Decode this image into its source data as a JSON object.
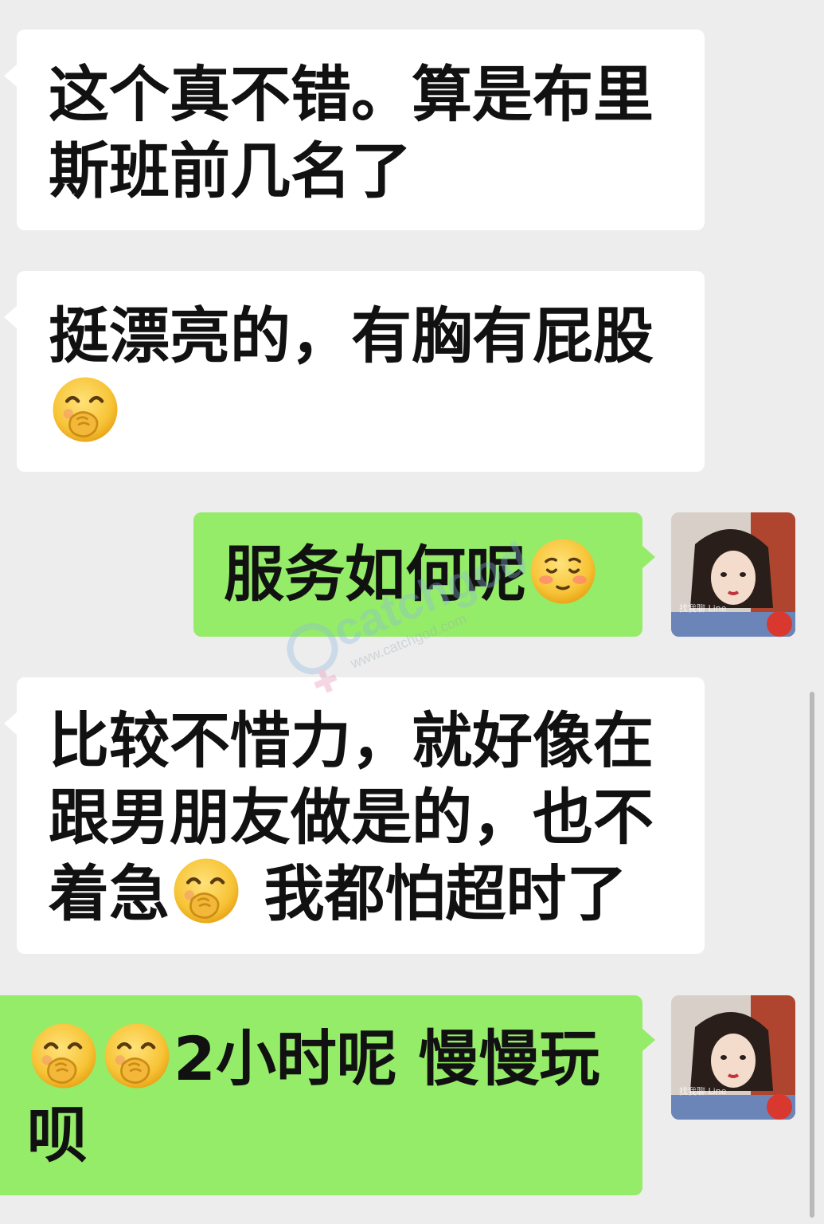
{
  "messages": [
    {
      "side": "in",
      "lines": [
        "这个真不错。算是布里",
        "斯班前几名了"
      ]
    },
    {
      "side": "in",
      "line1": "挺漂亮的，有胸有屁股",
      "emoji": "hand-over-mouth-emoji"
    },
    {
      "side": "out",
      "text": "服务如何呢",
      "emoji": "pleading-blush-emoji"
    },
    {
      "side": "in",
      "lines": [
        "比较不惜力，就好像在",
        "跟男朋友做是的，也不"
      ],
      "line3_before": "着急",
      "line3_after": " 我都怕超时了",
      "emoji": "hand-over-mouth-emoji"
    },
    {
      "side": "out",
      "line1_text": "2小时呢 慢慢玩",
      "line2": "呗",
      "emoji": "hand-over-mouth-emoji"
    }
  ],
  "avatar": {
    "icon": "profile-photo-woman",
    "caption": "找我聊 Line"
  },
  "watermark": {
    "brand": "catchgod",
    "url": "www.catchgod.com"
  },
  "colors": {
    "background": "#ededed",
    "incoming": "#ffffff",
    "outgoing": "#95ec69",
    "text": "#111111"
  }
}
